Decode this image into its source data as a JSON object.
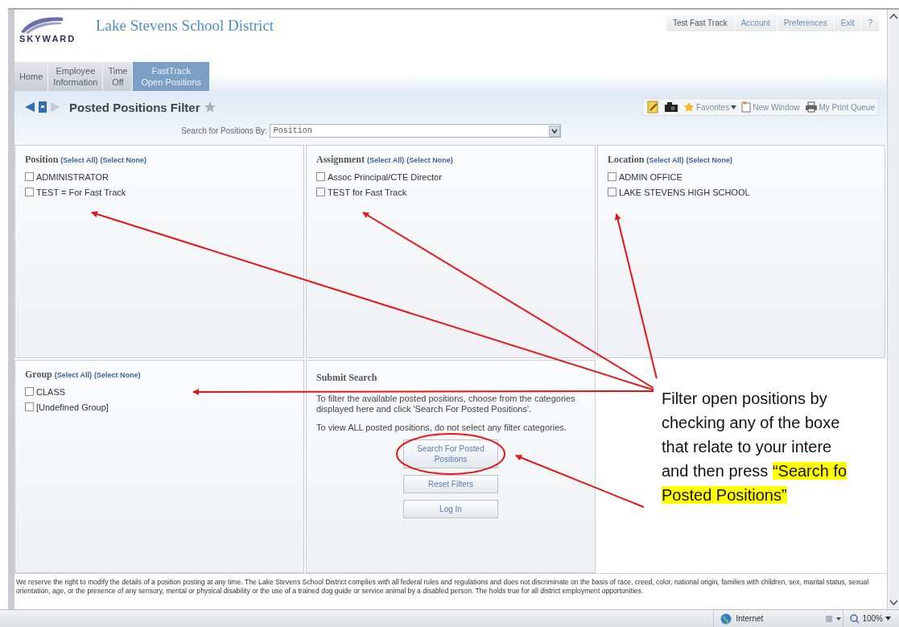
{
  "logo": "SKYWARD",
  "district_name": "Lake Stevens School District",
  "top_links": [
    "Test Fast Track",
    "Account",
    "Preferences",
    "Exit",
    "?"
  ],
  "tabs": [
    {
      "label": "Home",
      "selected": false
    },
    {
      "label": "Employee\nInformation",
      "selected": false
    },
    {
      "label": "Time\nOff",
      "selected": false
    },
    {
      "label": "FastTrack\nOpen Positions",
      "selected": true
    }
  ],
  "page_title": "Posted Positions Filter",
  "toolbar": {
    "favorites": "Favorites",
    "new_window": "New Window",
    "print_queue": "My Print Queue"
  },
  "search_by": {
    "label": "Search for Positions By:",
    "value": "Position"
  },
  "filters": [
    {
      "title": "Position",
      "select_all": "(Select All)",
      "select_none": "(Select None)",
      "options": [
        {
          "label": "ADMINISTRATOR",
          "checked": false
        },
        {
          "label": "TEST = For Fast Track",
          "checked": false
        }
      ]
    },
    {
      "title": "Assignment",
      "select_all": "(Select All)",
      "select_none": "(Select None)",
      "options": [
        {
          "label": "Assoc Principal/CTE Director",
          "checked": false
        },
        {
          "label": "TEST for Fast Track",
          "checked": false
        }
      ]
    },
    {
      "title": "Location",
      "select_all": "(Select All)",
      "select_none": "(Select None)",
      "options": [
        {
          "label": "ADMIN OFFICE",
          "checked": false
        },
        {
          "label": "LAKE STEVENS HIGH SCHOOL",
          "checked": false
        }
      ]
    },
    {
      "title": "Group",
      "select_all": "(Select All)",
      "select_none": "(Select None)",
      "options": [
        {
          "label": "CLASS",
          "checked": false
        },
        {
          "label": "[Undefined Group]",
          "checked": false
        }
      ]
    }
  ],
  "submit": {
    "title": "Submit Search",
    "paragraphs": [
      "To filter the available posted positions, choose from the categories displayed here and click 'Search For Posted Positions'.",
      "To view ALL posted positions, do not select any filter categories."
    ],
    "buttons": [
      "Search For Posted\nPositions",
      "Reset Filters",
      "Log In"
    ]
  },
  "disclaimer": "We reserve the right to modify the details of a position posting at any time. The Lake Stevens School District complies with all federal rules and regulations and does not discriminate on the basis of race, creed, color, national origin, families with children, sex, marital status, sexual orientation, age, or the presence of any sensory, mental or physical disability or the use of a trained dog guide or service animal by a disabled person. The holds true for all district employment opportunities.",
  "status_bar": {
    "zone": "Internet",
    "zoom": "100%"
  },
  "callout": {
    "lines": [
      [
        {
          "text": "Filter open positions by",
          "highlighted": false
        }
      ],
      [
        {
          "text": "checking any of the boxe",
          "highlighted": false
        }
      ],
      [
        {
          "text": "that relate to your intere",
          "highlighted": false
        }
      ],
      [
        {
          "text": "and then press ",
          "highlighted": false
        },
        {
          "text": "“Search fo",
          "highlighted": true
        }
      ],
      [
        {
          "text": "Posted Positions”",
          "highlighted": true
        }
      ]
    ]
  }
}
